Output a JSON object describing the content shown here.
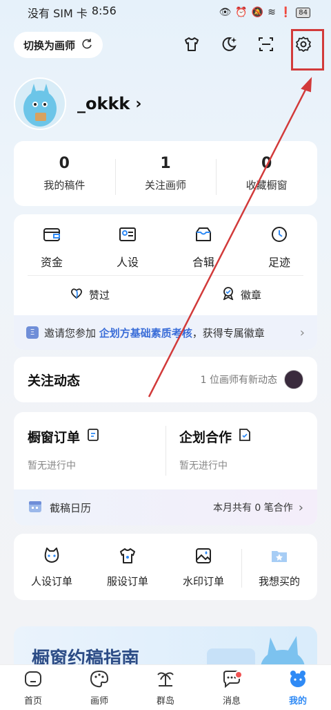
{
  "status_bar": {
    "carrier": "没有 SIM 卡",
    "time": "8:56",
    "battery": "84"
  },
  "topbar": {
    "switch_label": "切换为画师"
  },
  "profile": {
    "username": "_okkk"
  },
  "stats": [
    {
      "value": "0",
      "label": "我的稿件"
    },
    {
      "value": "1",
      "label": "关注画师"
    },
    {
      "value": "0",
      "label": "收藏橱窗"
    }
  ],
  "wallet": {
    "items": [
      {
        "label": "资金",
        "icon": "wallet-icon"
      },
      {
        "label": "人设",
        "icon": "id-card-icon"
      },
      {
        "label": "合辑",
        "icon": "box-icon"
      },
      {
        "label": "足迹",
        "icon": "clock-icon"
      }
    ],
    "row2": [
      {
        "label": "赞过",
        "icon": "heart-icon"
      },
      {
        "label": "徽章",
        "icon": "badge-icon"
      }
    ],
    "invite": {
      "prefix": "邀请您参加 ",
      "highlight": "企划方基础素质考核",
      "suffix": "，获得专属徽章"
    }
  },
  "follow": {
    "title": "关注动态",
    "note": "1 位画师有新动态"
  },
  "orders": {
    "cols": [
      {
        "title": "橱窗订单",
        "sub": "暂无进行中"
      },
      {
        "title": "企划合作",
        "sub": "暂无进行中"
      }
    ],
    "calendar": {
      "label": "截稿日历",
      "right": "本月共有 0 笔合作"
    }
  },
  "order_types": [
    {
      "label": "人设订单",
      "icon": "cat-face-icon"
    },
    {
      "label": "服设订单",
      "icon": "shirt-icon"
    },
    {
      "label": "水印订单",
      "icon": "image-icon"
    },
    {
      "label": "我想买的",
      "icon": "star-folder-icon"
    }
  ],
  "guide": {
    "title": "橱窗约稿指南"
  },
  "tabbar": [
    {
      "label": "首页",
      "icon": "home-icon"
    },
    {
      "label": "画师",
      "icon": "palette-icon"
    },
    {
      "label": "群岛",
      "icon": "island-icon"
    },
    {
      "label": "消息",
      "icon": "chat-icon"
    },
    {
      "label": "我的",
      "icon": "bear-icon"
    }
  ],
  "colors": {
    "accent": "#2f8af5",
    "highlight": "#3a6dd8",
    "annotation": "#d23a3a"
  }
}
